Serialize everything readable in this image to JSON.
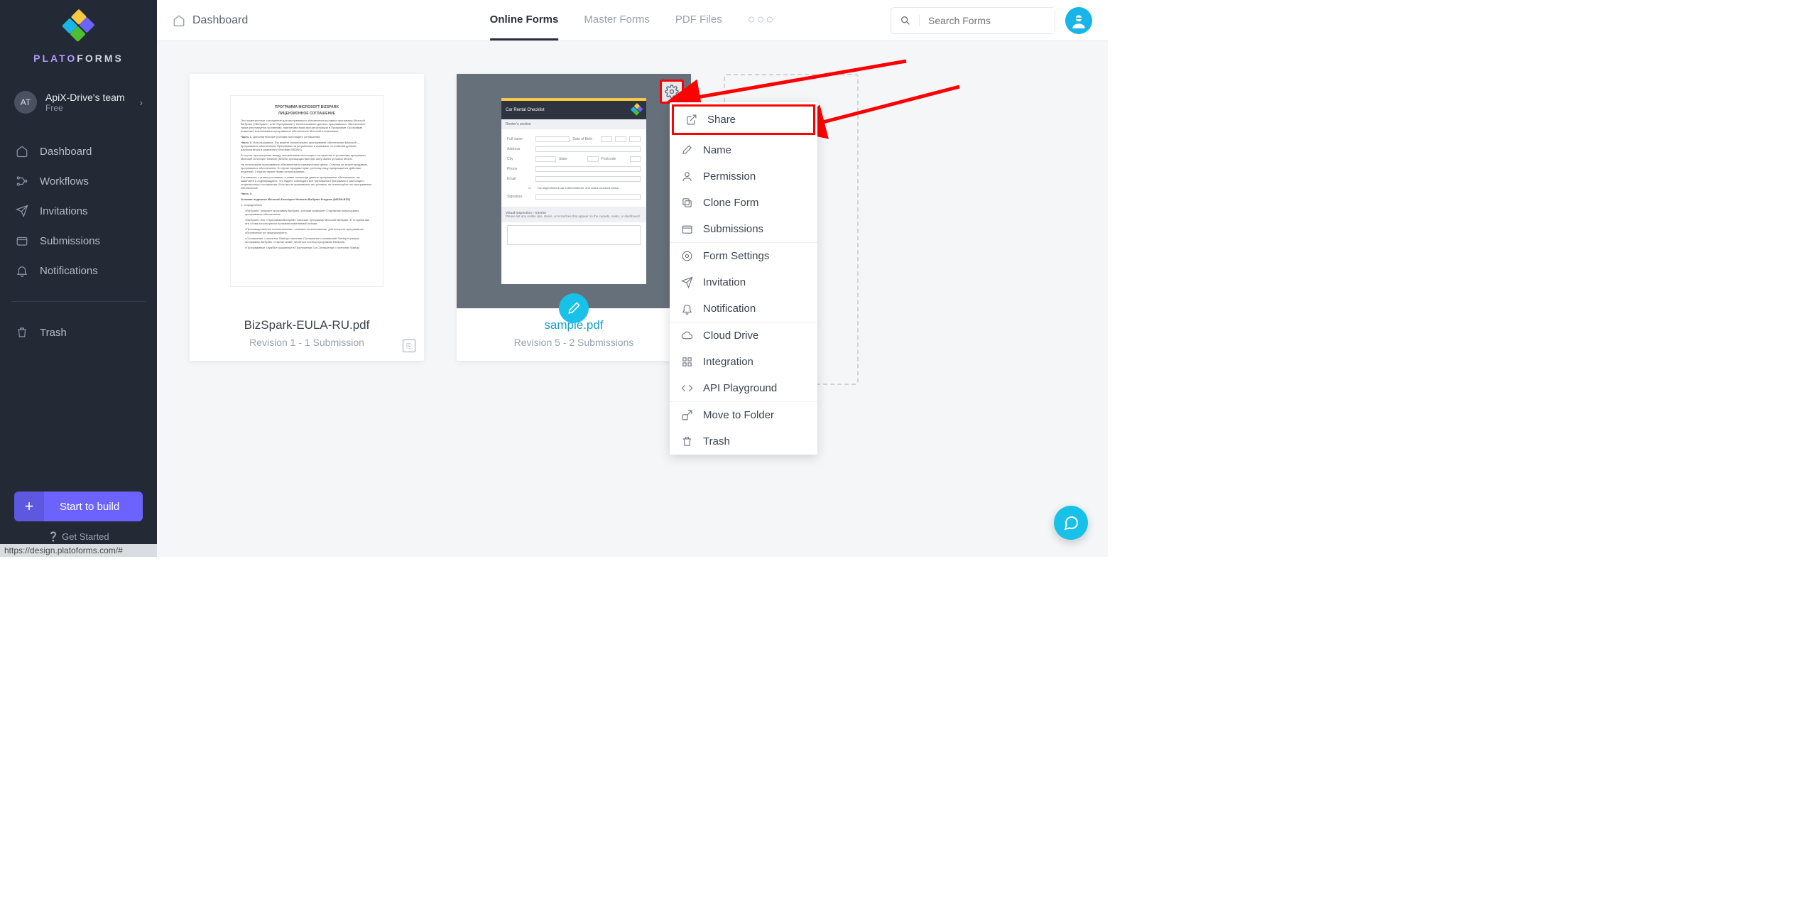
{
  "brand": {
    "plato": "PLATO",
    "forms": "FORMS"
  },
  "team": {
    "initials": "AT",
    "name": "ApiX-Drive's team",
    "plan": "Free"
  },
  "sidebar": {
    "items": [
      {
        "label": "Dashboard"
      },
      {
        "label": "Workflows"
      },
      {
        "label": "Invitations"
      },
      {
        "label": "Submissions"
      },
      {
        "label": "Notifications"
      },
      {
        "label": "Trash"
      }
    ],
    "start_btn": "Start to build",
    "get_started": "Get Started"
  },
  "header": {
    "breadcrumb": "Dashboard",
    "tabs": [
      {
        "label": "Online Forms",
        "active": true
      },
      {
        "label": "Master Forms"
      },
      {
        "label": "PDF Files"
      }
    ],
    "search_placeholder": "Search Forms"
  },
  "cards": [
    {
      "title": "BizSpark-EULA-RU.pdf",
      "subtitle": "Revision 1 - 1 Submission",
      "doc_heading_a": "ПРОГРАММА MICROSOFT BIZSPARK",
      "doc_heading_b": "ЛИЦЕНЗИОННОЕ СОГЛАШЕНИЕ"
    },
    {
      "title": "sample.pdf",
      "subtitle": "Revision 5 - 2 Submissions",
      "doc_title": "Car Rental Checklist",
      "doc_section": "Renter's section",
      "doc_labels": {
        "full_name": "Full name",
        "dob": "Date of Birth",
        "address": "Address",
        "city": "City",
        "state": "State",
        "postcode": "Postcode",
        "phone": "Phone",
        "email": "Email",
        "confirm": "I've inspected the car exterior/interior, and noted concerns below.",
        "signature": "Signature",
        "visual": "Visual Inspection – Interior",
        "note": "Please list any visible rips, stains, or scratches that appear on the carpets, seats, or dashboard."
      }
    }
  ],
  "menu": {
    "share": "Share",
    "name": "Name",
    "permission": "Permission",
    "clone": "Clone Form",
    "submissions": "Submissions",
    "form_settings": "Form Settings",
    "invitation": "Invitation",
    "notification": "Notification",
    "cloud": "Cloud Drive",
    "integration": "Integration",
    "api": "API Playground",
    "move": "Move to Folder",
    "trash": "Trash"
  },
  "status": "https://design.platoforms.com/#"
}
